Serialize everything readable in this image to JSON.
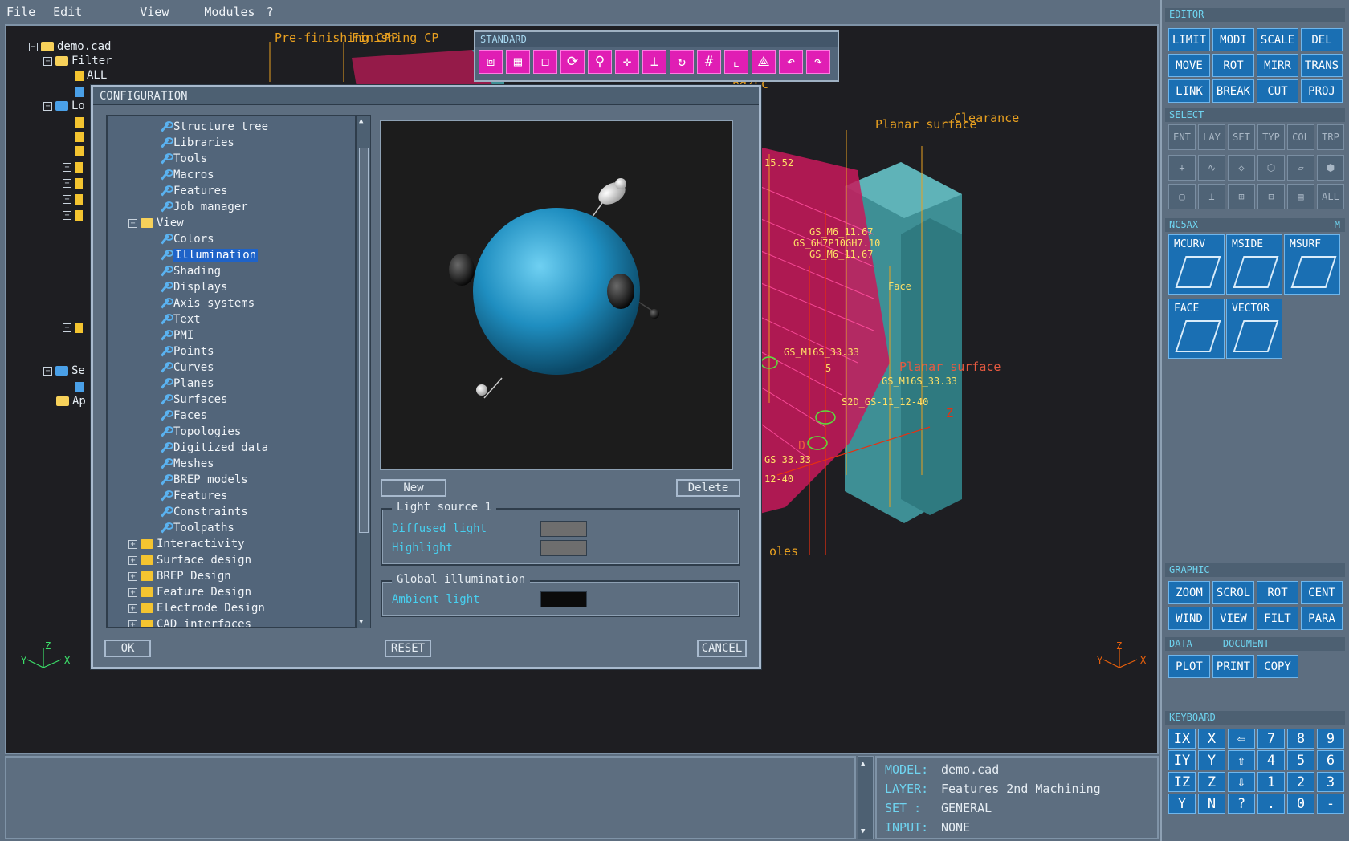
{
  "menu": {
    "file": "File",
    "edit": "Edit",
    "view": "View",
    "modules": "Modules",
    "help": "?"
  },
  "tree": {
    "root": "demo.cad",
    "filter": "Filter",
    "all": "ALL",
    "lo": "Lo",
    "se": "Se",
    "ap": "Ap"
  },
  "cad_labels": {
    "prefinishing": "Pre-finishing CP",
    "finishing": "Finishing CP",
    "ap": "AP",
    "ngzlc": "ngZLC",
    "planar": "Planar surface",
    "clearance": "Clearance",
    "s1": "15.52",
    "g1": "GS_M6_11.67",
    "g2": "GS_6H7P10GH7.10",
    "g3": "GS_M6_11.67",
    "g4": "GS_M16S_33.33",
    "g5": "GS_M16S_33.33",
    "g6": "S2D_GS-11_12-40",
    "g7": "GS_33.33",
    "g8": "12-40",
    "planar2": "Planar surface",
    "face": "Face",
    "poles": "oles",
    "z": "Z",
    "d": "D",
    "five": "5"
  },
  "axes": {
    "x": "X",
    "y": "Y",
    "z": "Z"
  },
  "standard": {
    "title": "STANDARD",
    "icons": [
      "cube-wire-icon",
      "cube-shaded-icon",
      "cube-icon",
      "rotate-icon",
      "zoom-icon",
      "pan-icon",
      "axis-icon",
      "refresh-icon",
      "grid-icon",
      "frame-icon",
      "plane-icon",
      "undo-icon",
      "redo-icon"
    ],
    "glyphs": [
      "⧈",
      "▦",
      "◻",
      "⟳",
      "⚲",
      "✛",
      "⊥",
      "↻",
      "#",
      "⌞",
      "⟁",
      "↶",
      "↷"
    ]
  },
  "editor": {
    "title": "EDITOR",
    "buttons": [
      "LIMIT",
      "MODI",
      "SCALE",
      "DEL",
      "MOVE",
      "ROT",
      "MIRR",
      "TRANS",
      "LINK",
      "BREAK",
      "CUT",
      "PROJ"
    ]
  },
  "select": {
    "title": "SELECT",
    "buttons": [
      "ENT",
      "LAY",
      "SET",
      "TYP",
      "COL",
      "TRP"
    ],
    "last": "ALL",
    "glyphs": [
      "+",
      "∿",
      "◇",
      "⬡",
      "▱",
      "⬢",
      "▢",
      "⊥",
      "⊞",
      "⊟",
      "▤"
    ]
  },
  "nc5ax": {
    "title": "NC5AX",
    "m": "M",
    "buttons": [
      "MCURV",
      "MSIDE",
      "MSURF",
      "FACE",
      "VECTOR"
    ]
  },
  "graphic": {
    "title": "GRAPHIC",
    "buttons": [
      "ZOOM",
      "SCROL",
      "ROT",
      "CENT",
      "WIND",
      "VIEW",
      "FILT",
      "PARA"
    ]
  },
  "data_doc": {
    "data": "DATA",
    "document": "DOCUMENT",
    "buttons": [
      "PLOT",
      "PRINT",
      "COPY"
    ]
  },
  "keyboard": {
    "title": "KEYBOARD",
    "keys": [
      "IX",
      "X",
      "⇦",
      "7",
      "8",
      "9",
      "IY",
      "Y",
      "⇧",
      "4",
      "5",
      "6",
      "IZ",
      "Z",
      "⇩",
      "1",
      "2",
      "3",
      "Y",
      "N",
      "?",
      ".",
      "0",
      "-"
    ]
  },
  "status": {
    "model_k": "MODEL:",
    "model_v": "demo.cad",
    "layer_k": "LAYER:",
    "layer_v": "Features 2nd Machining",
    "set_k": "SET  :",
    "set_v": "GENERAL",
    "input_k": "INPUT:",
    "input_v": "NONE"
  },
  "dialog": {
    "title": "CONFIGURATION",
    "items": [
      {
        "label": "Structure tree",
        "type": "leaf",
        "indent": 2
      },
      {
        "label": "Libraries",
        "type": "leaf",
        "indent": 2
      },
      {
        "label": "Tools",
        "type": "leaf",
        "indent": 2
      },
      {
        "label": "Macros",
        "type": "leaf",
        "indent": 2
      },
      {
        "label": "Features",
        "type": "leaf",
        "indent": 2
      },
      {
        "label": "Job manager",
        "type": "leaf",
        "indent": 2
      },
      {
        "label": "View",
        "type": "open",
        "indent": 1
      },
      {
        "label": "Colors",
        "type": "leaf",
        "indent": 2
      },
      {
        "label": "Illumination",
        "type": "leaf",
        "indent": 2,
        "selected": true
      },
      {
        "label": "Shading",
        "type": "leaf",
        "indent": 2
      },
      {
        "label": "Displays",
        "type": "leaf",
        "indent": 2
      },
      {
        "label": "Axis systems",
        "type": "leaf",
        "indent": 2
      },
      {
        "label": "Text",
        "type": "leaf",
        "indent": 2
      },
      {
        "label": "PMI",
        "type": "leaf",
        "indent": 2
      },
      {
        "label": "Points",
        "type": "leaf",
        "indent": 2
      },
      {
        "label": "Curves",
        "type": "leaf",
        "indent": 2
      },
      {
        "label": "Planes",
        "type": "leaf",
        "indent": 2
      },
      {
        "label": "Surfaces",
        "type": "leaf",
        "indent": 2
      },
      {
        "label": "Faces",
        "type": "leaf",
        "indent": 2
      },
      {
        "label": "Topologies",
        "type": "leaf",
        "indent": 2
      },
      {
        "label": "Digitized data",
        "type": "leaf",
        "indent": 2
      },
      {
        "label": "Meshes",
        "type": "leaf",
        "indent": 2
      },
      {
        "label": "BREP models",
        "type": "leaf",
        "indent": 2
      },
      {
        "label": "Features",
        "type": "leaf",
        "indent": 2
      },
      {
        "label": "Constraints",
        "type": "leaf",
        "indent": 2
      },
      {
        "label": "Toolpaths",
        "type": "leaf",
        "indent": 2
      },
      {
        "label": "Interactivity",
        "type": "closed",
        "indent": 1
      },
      {
        "label": "Surface design",
        "type": "closed",
        "indent": 1
      },
      {
        "label": "BREP Design",
        "type": "closed",
        "indent": 1
      },
      {
        "label": "Feature Design",
        "type": "closed",
        "indent": 1
      },
      {
        "label": "Electrode Design",
        "type": "closed",
        "indent": 1
      },
      {
        "label": "CAD interfaces",
        "type": "closed",
        "indent": 1
      }
    ],
    "new_label": "New",
    "delete_label": "Delete",
    "light_group": "Light source 1",
    "diffused": "Diffused light",
    "highlight": "Highlight",
    "global_group": "Global illumination",
    "ambient": "Ambient light",
    "ok": "OK",
    "reset": "RESET",
    "cancel": "CANCEL",
    "colors": {
      "diffused": "#6e6e6e",
      "highlight": "#6e6e6e",
      "ambient": "#0b0b0b"
    }
  }
}
